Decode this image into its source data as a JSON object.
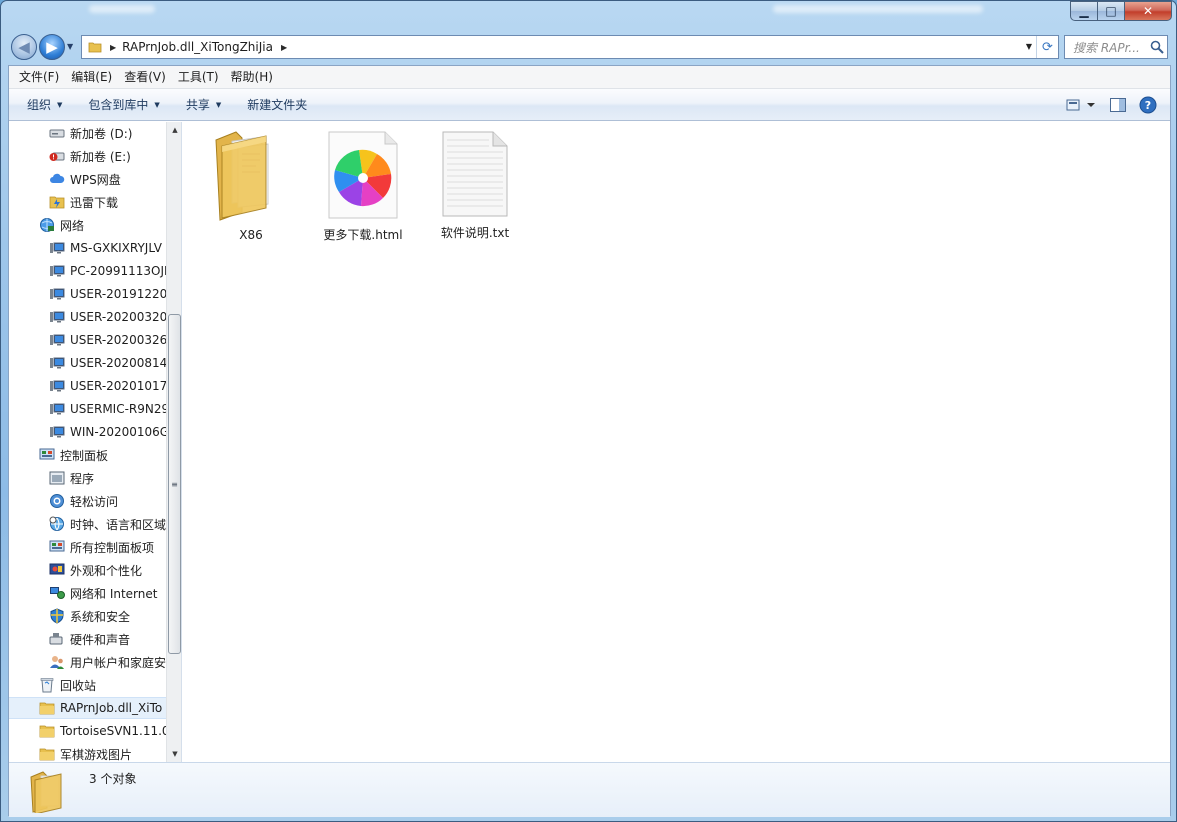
{
  "window": {
    "controls": {
      "minimize": "▁",
      "maximize": "□",
      "close": "✕"
    }
  },
  "address": {
    "breadcrumb": "RAPrnJob.dll_XiTongZhiJia",
    "search_placeholder": "搜索 RAPr..."
  },
  "menubar": {
    "items": [
      "文件(F)",
      "编辑(E)",
      "查看(V)",
      "工具(T)",
      "帮助(H)"
    ]
  },
  "toolbar": {
    "organize": "组织",
    "include_in_library": "包含到库中",
    "share": "共享",
    "new_folder": "新建文件夹"
  },
  "navpane": {
    "items": [
      {
        "label": "新加卷 (D:)",
        "icon": "drive-icon",
        "indent": 2
      },
      {
        "label": "新加卷 (E:)",
        "icon": "drive-error-icon",
        "indent": 2
      },
      {
        "label": "WPS网盘",
        "icon": "cloud-icon",
        "indent": 2
      },
      {
        "label": "迅雷下载",
        "icon": "thunder-folder-icon",
        "indent": 2
      },
      {
        "label": "网络",
        "icon": "network-icon",
        "indent": 1
      },
      {
        "label": "MS-GXKIXRYJLV",
        "icon": "computer-icon",
        "indent": 2
      },
      {
        "label": "PC-20991113OJE",
        "icon": "computer-icon",
        "indent": 2
      },
      {
        "label": "USER-20191220I",
        "icon": "computer-icon",
        "indent": 2
      },
      {
        "label": "USER-20200320",
        "icon": "computer-icon",
        "indent": 2
      },
      {
        "label": "USER-20200326V",
        "icon": "computer-icon",
        "indent": 2
      },
      {
        "label": "USER-20200814/",
        "icon": "computer-icon",
        "indent": 2
      },
      {
        "label": "USER-20201017I",
        "icon": "computer-icon",
        "indent": 2
      },
      {
        "label": "USERMIC-R9N29",
        "icon": "computer-icon",
        "indent": 2
      },
      {
        "label": "WIN-20200106G",
        "icon": "computer-icon",
        "indent": 2
      },
      {
        "label": "控制面板",
        "icon": "control-panel-icon",
        "indent": 1
      },
      {
        "label": "程序",
        "icon": "programs-icon",
        "indent": 2
      },
      {
        "label": "轻松访问",
        "icon": "ease-of-access-icon",
        "indent": 2
      },
      {
        "label": "时钟、语言和区域",
        "icon": "clock-globe-icon",
        "indent": 2
      },
      {
        "label": "所有控制面板项",
        "icon": "control-panel-icon",
        "indent": 2
      },
      {
        "label": "外观和个性化",
        "icon": "appearance-icon",
        "indent": 2
      },
      {
        "label": "网络和 Internet",
        "icon": "network-internet-icon",
        "indent": 2
      },
      {
        "label": "系统和安全",
        "icon": "system-security-icon",
        "indent": 2
      },
      {
        "label": "硬件和声音",
        "icon": "hardware-sound-icon",
        "indent": 2
      },
      {
        "label": "用户帐户和家庭安",
        "icon": "user-accounts-icon",
        "indent": 2
      },
      {
        "label": "回收站",
        "icon": "recycle-bin-icon",
        "indent": 1
      },
      {
        "label": "RAPrnJob.dll_XiTo",
        "icon": "folder-icon",
        "indent": 1,
        "selected": true
      },
      {
        "label": "TortoiseSVN1.11.0",
        "icon": "folder-icon",
        "indent": 1
      },
      {
        "label": "军棋游戏图片",
        "icon": "folder-icon",
        "indent": 1
      }
    ]
  },
  "files": [
    {
      "name": "X86",
      "icon": "folder-icon"
    },
    {
      "name": "更多下载.html",
      "icon": "html-browser-icon"
    },
    {
      "name": "软件说明.txt",
      "icon": "text-file-icon"
    }
  ],
  "details": {
    "count_text": "3 个对象"
  }
}
